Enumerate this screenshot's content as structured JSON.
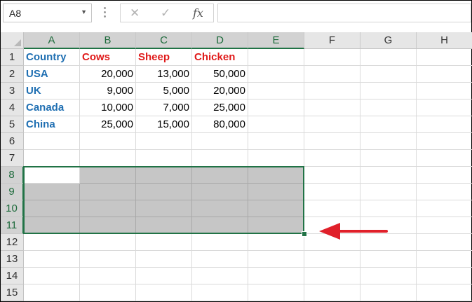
{
  "namebox": {
    "value": "A8"
  },
  "formula_bar": {
    "cancel_icon": "close-icon",
    "enter_icon": "check-icon",
    "function_label": "fx",
    "formula_value": ""
  },
  "columns": [
    "A",
    "B",
    "C",
    "D",
    "E",
    "F",
    "G",
    "H"
  ],
  "rows": [
    "1",
    "2",
    "3",
    "4",
    "5",
    "6",
    "7",
    "8",
    "9",
    "10",
    "11",
    "12",
    "13",
    "14",
    "15"
  ],
  "table": {
    "header": {
      "country": "Country",
      "cows": "Cows",
      "sheep": "Sheep",
      "chicken": "Chicken"
    },
    "data": [
      {
        "country": "USA",
        "cows": "20,000",
        "sheep": "13,000",
        "chicken": "50,000"
      },
      {
        "country": "UK",
        "cows": "9,000",
        "sheep": "5,000",
        "chicken": "20,000"
      },
      {
        "country": "Canada",
        "cows": "10,000",
        "sheep": "7,000",
        "chicken": "25,000"
      },
      {
        "country": "China",
        "cows": "25,000",
        "sheep": "15,000",
        "chicken": "80,000"
      }
    ]
  },
  "selection": {
    "range": "A8:E11",
    "active_cell": "A8"
  },
  "colors": {
    "header_blue": "#1f6fb2",
    "header_red": "#e01a1a",
    "selection_green": "#217346",
    "selection_fill": "#c6c6c6",
    "arrow_red": "#e0202a"
  }
}
